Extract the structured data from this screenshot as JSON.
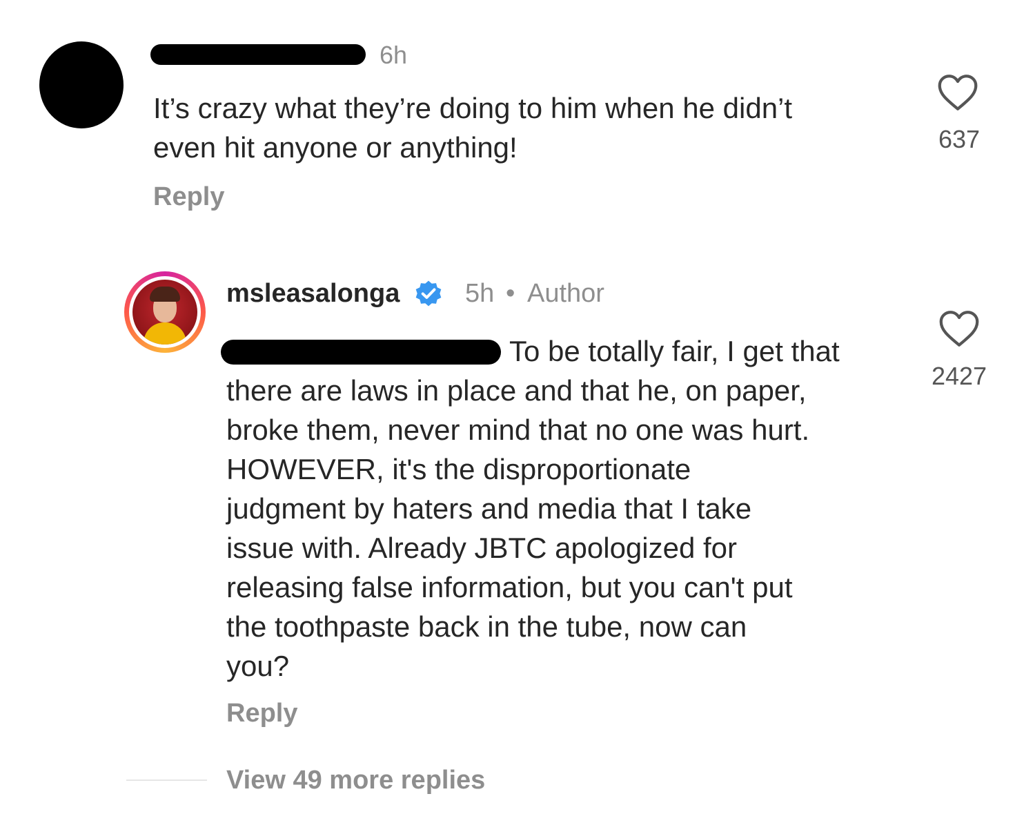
{
  "comment": {
    "username": "",
    "time": "6h",
    "text": "It’s crazy what they’re doing to him when he didn’t\neven hit anyone or anything!",
    "like_count": "637",
    "reply_label": "Reply"
  },
  "reply_comment": {
    "username": "msleasalonga",
    "verified": true,
    "time": "5h",
    "dot": "•",
    "author_label": "Author",
    "first_line": "To be totally fair, I get that",
    "text": "there are laws in place and that he, on paper,\nbroke them, never mind that no one was hurt.\nHOWEVER, it's the disproportionate\njudgment by haters and media that I take\nissue with. Already JBTC apologized for\nreleasing false information, but you can't put\nthe toothpaste back in the tube, now can\nyou?",
    "like_count": "2427",
    "reply_label": "Reply"
  },
  "view_more": "View 49 more replies",
  "icons": {
    "like": "heart-outline-icon",
    "verified": "verified-badge-icon"
  },
  "colors": {
    "text": "#262626",
    "muted": "#8e8e8e",
    "verified": "#3897f0",
    "background": "#ffffff"
  }
}
